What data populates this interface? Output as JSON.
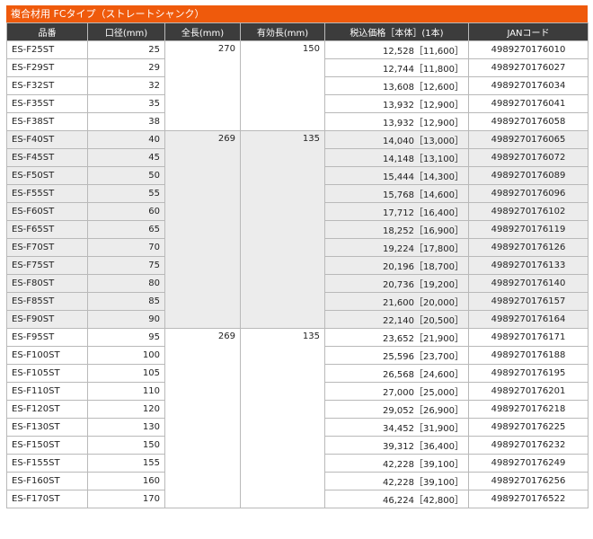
{
  "caption": "複合材用 FCタイプ（ストレートシャンク）",
  "headers": [
    "品番",
    "口径(mm)",
    "全長(mm)",
    "有効長(mm)",
    "税込価格［本体］(1本)",
    "JANコード"
  ],
  "groups": [
    {
      "total_length": "270",
      "effective_length": "150",
      "shade": false,
      "rows": [
        {
          "model": "ES-F25ST",
          "diameter": "25",
          "price": "12,528［11,600］",
          "jan": "4989270176010"
        },
        {
          "model": "ES-F29ST",
          "diameter": "29",
          "price": "12,744［11,800］",
          "jan": "4989270176027"
        },
        {
          "model": "ES-F32ST",
          "diameter": "32",
          "price": "13,608［12,600］",
          "jan": "4989270176034"
        },
        {
          "model": "ES-F35ST",
          "diameter": "35",
          "price": "13,932［12,900］",
          "jan": "4989270176041"
        },
        {
          "model": "ES-F38ST",
          "diameter": "38",
          "price": "13,932［12,900］",
          "jan": "4989270176058"
        }
      ]
    },
    {
      "total_length": "269",
      "effective_length": "135",
      "shade": true,
      "rows": [
        {
          "model": "ES-F40ST",
          "diameter": "40",
          "price": "14,040［13,000］",
          "jan": "4989270176065"
        },
        {
          "model": "ES-F45ST",
          "diameter": "45",
          "price": "14,148［13,100］",
          "jan": "4989270176072"
        },
        {
          "model": "ES-F50ST",
          "diameter": "50",
          "price": "15,444［14,300］",
          "jan": "4989270176089"
        },
        {
          "model": "ES-F55ST",
          "diameter": "55",
          "price": "15,768［14,600］",
          "jan": "4989270176096"
        },
        {
          "model": "ES-F60ST",
          "diameter": "60",
          "price": "17,712［16,400］",
          "jan": "4989270176102"
        },
        {
          "model": "ES-F65ST",
          "diameter": "65",
          "price": "18,252［16,900］",
          "jan": "4989270176119"
        },
        {
          "model": "ES-F70ST",
          "diameter": "70",
          "price": "19,224［17,800］",
          "jan": "4989270176126"
        },
        {
          "model": "ES-F75ST",
          "diameter": "75",
          "price": "20,196［18,700］",
          "jan": "4989270176133"
        },
        {
          "model": "ES-F80ST",
          "diameter": "80",
          "price": "20,736［19,200］",
          "jan": "4989270176140"
        },
        {
          "model": "ES-F85ST",
          "diameter": "85",
          "price": "21,600［20,000］",
          "jan": "4989270176157"
        },
        {
          "model": "ES-F90ST",
          "diameter": "90",
          "price": "22,140［20,500］",
          "jan": "4989270176164"
        }
      ]
    },
    {
      "total_length": "269",
      "effective_length": "135",
      "shade": false,
      "rows": [
        {
          "model": "ES-F95ST",
          "diameter": "95",
          "price": "23,652［21,900］",
          "jan": "4989270176171"
        },
        {
          "model": "ES-F100ST",
          "diameter": "100",
          "price": "25,596［23,700］",
          "jan": "4989270176188"
        },
        {
          "model": "ES-F105ST",
          "diameter": "105",
          "price": "26,568［24,600］",
          "jan": "4989270176195"
        },
        {
          "model": "ES-F110ST",
          "diameter": "110",
          "price": "27,000［25,000］",
          "jan": "4989270176201"
        },
        {
          "model": "ES-F120ST",
          "diameter": "120",
          "price": "29,052［26,900］",
          "jan": "4989270176218"
        },
        {
          "model": "ES-F130ST",
          "diameter": "130",
          "price": "34,452［31,900］",
          "jan": "4989270176225"
        },
        {
          "model": "ES-F150ST",
          "diameter": "150",
          "price": "39,312［36,400］",
          "jan": "4989270176232"
        },
        {
          "model": "ES-F155ST",
          "diameter": "155",
          "price": "42,228［39,100］",
          "jan": "4989270176249"
        },
        {
          "model": "ES-F160ST",
          "diameter": "160",
          "price": "42,228［39,100］",
          "jan": "4989270176256"
        },
        {
          "model": "ES-F170ST",
          "diameter": "170",
          "price": "46,224［42,800］",
          "jan": "4989270176522"
        }
      ]
    }
  ]
}
